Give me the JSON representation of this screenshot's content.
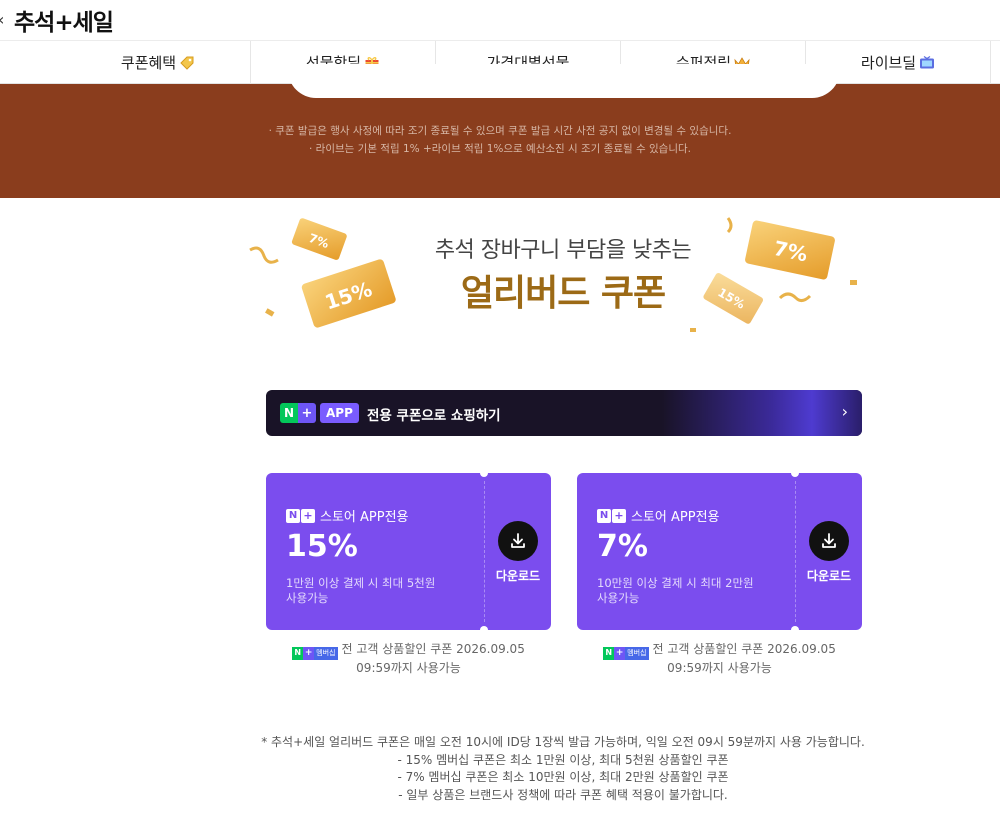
{
  "header": {
    "brand": "추석+세일"
  },
  "tabs": [
    {
      "label": "쿠폰혜택",
      "icon": "tag-icon"
    },
    {
      "label": "선물핫딜",
      "icon": "gift-icon"
    },
    {
      "label": "가격대별선물",
      "icon": ""
    },
    {
      "label": "슈퍼적립",
      "icon": "crown-icon"
    },
    {
      "label": "라이브딜",
      "icon": "tv-icon"
    }
  ],
  "banner": {
    "notices": [
      "· 쿠폰 발급은 행사 사정에 따라 조기 종료될 수 있으며 쿠폰 발급 시간 사전 공지 없이 변경될 수 있습니다.",
      "· 라이브는 기본 적립 1% +라이브 적립 1%으로 예산소진 시 조기 종료될 수 있습니다."
    ]
  },
  "hero": {
    "subtitle": "추석 장바구니 부담을 낮추는",
    "title": "얼리버드 쿠폰",
    "decor_tickets": [
      "7%",
      "15%",
      "7%",
      "15%"
    ]
  },
  "app_banner": {
    "badge_n": "N",
    "badge_plus": "+",
    "badge_app": "APP",
    "text": "전용 쿠폰으로 쇼핑하기"
  },
  "coupons": [
    {
      "header": "스토어 APP전용",
      "rate": "15%",
      "desc_line1": "1만원 이상 결제 시 최대 5천원",
      "desc_line2": "사용가능",
      "download_label": "다운로드",
      "badge_text": "멤버십",
      "note_line1": "전 고객 상품할인 쿠폰 2026.09.05",
      "note_line2": "09:59까지 사용가능"
    },
    {
      "header": "스토어 APP전용",
      "rate": "7%",
      "desc_line1": "10만원 이상 결제 시 최대 2만원",
      "desc_line2": "사용가능",
      "download_label": "다운로드",
      "badge_text": "멤버십",
      "note_line1": "전 고객 상품할인 쿠폰 2026.09.05",
      "note_line2": "09:59까지 사용가능"
    }
  ],
  "footnotes": [
    "* 추석+세일 얼리버드 쿠폰은 매일 오전 10시에 ID당 1장씩 발급 가능하며, 익일 오전 09시 59분까지 사용 가능합니다.",
    "- 15% 멤버십 쿠폰은 최소 1만원 이상, 최대 5천원 상품할인 쿠폰",
    "- 7% 멤버십 쿠폰은 최소 10만원 이상, 최대 2만원 상품할인 쿠폰",
    "- 일부 상품은 브랜드사 정책에 따라 쿠폰 혜택 적용이 불가합니다."
  ],
  "colors": {
    "banner_brown": "#8a3d1d",
    "coupon_purple": "#7b4dee",
    "app_banner_dark": "#191327",
    "naver_green": "#03c75a",
    "title_gold": "#9c6a16"
  }
}
